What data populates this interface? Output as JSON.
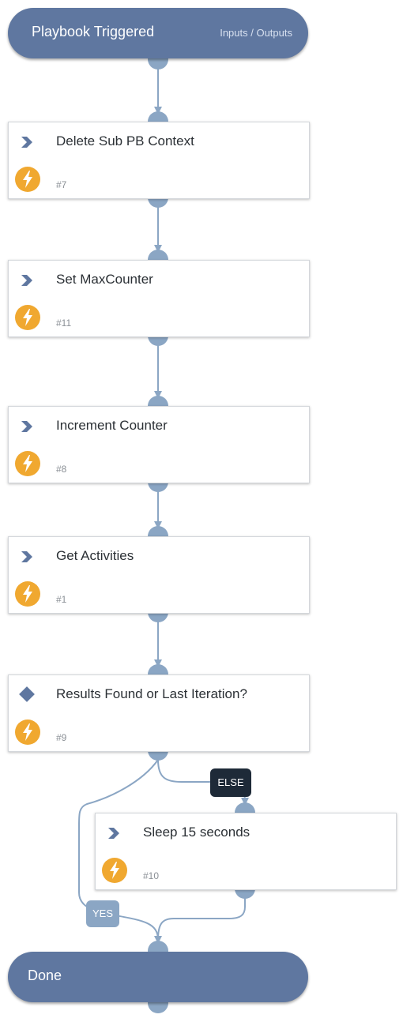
{
  "start": {
    "title": "Playbook Triggered",
    "link": "Inputs / Outputs"
  },
  "tasks": [
    {
      "title": "Delete Sub PB Context",
      "id": "#7",
      "kind": "action"
    },
    {
      "title": "Set MaxCounter",
      "id": "#11",
      "kind": "action"
    },
    {
      "title": "Increment Counter",
      "id": "#8",
      "kind": "action"
    },
    {
      "title": "Get Activities",
      "id": "#1",
      "kind": "action"
    },
    {
      "title": "Results Found or Last Iteration?",
      "id": "#9",
      "kind": "condition"
    },
    {
      "title": "Sleep 15 seconds",
      "id": "#10",
      "kind": "action"
    }
  ],
  "branches": {
    "else_label": "ELSE",
    "yes_label": "YES"
  },
  "end": {
    "title": "Done"
  },
  "colors": {
    "pill": "#5f77a0",
    "port": "#8ba6c4",
    "connector": "#8ba6c4",
    "bolt": "#f0a830",
    "else_badge": "#1e2a38",
    "yes_badge": "#8ba6c4"
  }
}
